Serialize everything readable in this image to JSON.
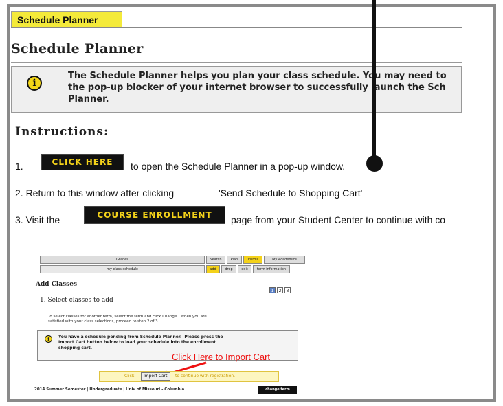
{
  "tab": {
    "label": "Schedule Planner"
  },
  "page_title": "Schedule Planner",
  "notice": {
    "line1": "The Schedule Planner helps you plan your class schedule. You may need to",
    "line2": "the pop-up blocker of your internet browser to successfully launch the Sch",
    "line3": "Planner."
  },
  "instructions_heading": "Instructions:",
  "steps": {
    "s1_num": "1.",
    "s1_button": "CLICK HERE",
    "s1_text": "to open the Schedule Planner in a pop-up window.",
    "s2_text": "2. Return to this window after clicking",
    "s2_quote": "'Send Schedule to Shopping Cart'",
    "s3_text": "3. Visit the",
    "s3_button": "COURSE ENROLLMENT",
    "s3_after": "page from your Student Center to continue with co"
  },
  "embedded": {
    "nav": [
      {
        "label": "Grades",
        "active": false
      },
      {
        "label": "Search",
        "active": false
      },
      {
        "label": "Plan",
        "active": false
      },
      {
        "label": "Enroll",
        "active": true
      },
      {
        "label": "My Academics",
        "active": false
      }
    ],
    "subnav": [
      {
        "label": "my class schedule",
        "active": false
      },
      {
        "label": "add",
        "active": true
      },
      {
        "label": "drop",
        "active": false
      },
      {
        "label": "edit",
        "active": false
      },
      {
        "label": "term information",
        "active": false
      }
    ],
    "add_classes": "Add Classes",
    "step_dots": [
      "1",
      "2",
      "3"
    ],
    "select_heading": "1. Select classes to add",
    "small_text": "To select classes for another term, select the term and click Change.  When you are\nsatisfied with your class selections, proceed to step 2 of 3.",
    "box_text": "You have a schedule pending from Schedule Planner.  Please press the\nImport Cart button below to load your schedule into the enrollment\nshopping cart.",
    "click_here_import": "Click Here to Import Cart",
    "click_label": "Click",
    "import_button": "Import Cart",
    "continue_text": "to continue with registration.",
    "footer": "2014 Summer Semester | Undergraduate | Univ of Missouri - Columbia",
    "change_term": "change term"
  }
}
